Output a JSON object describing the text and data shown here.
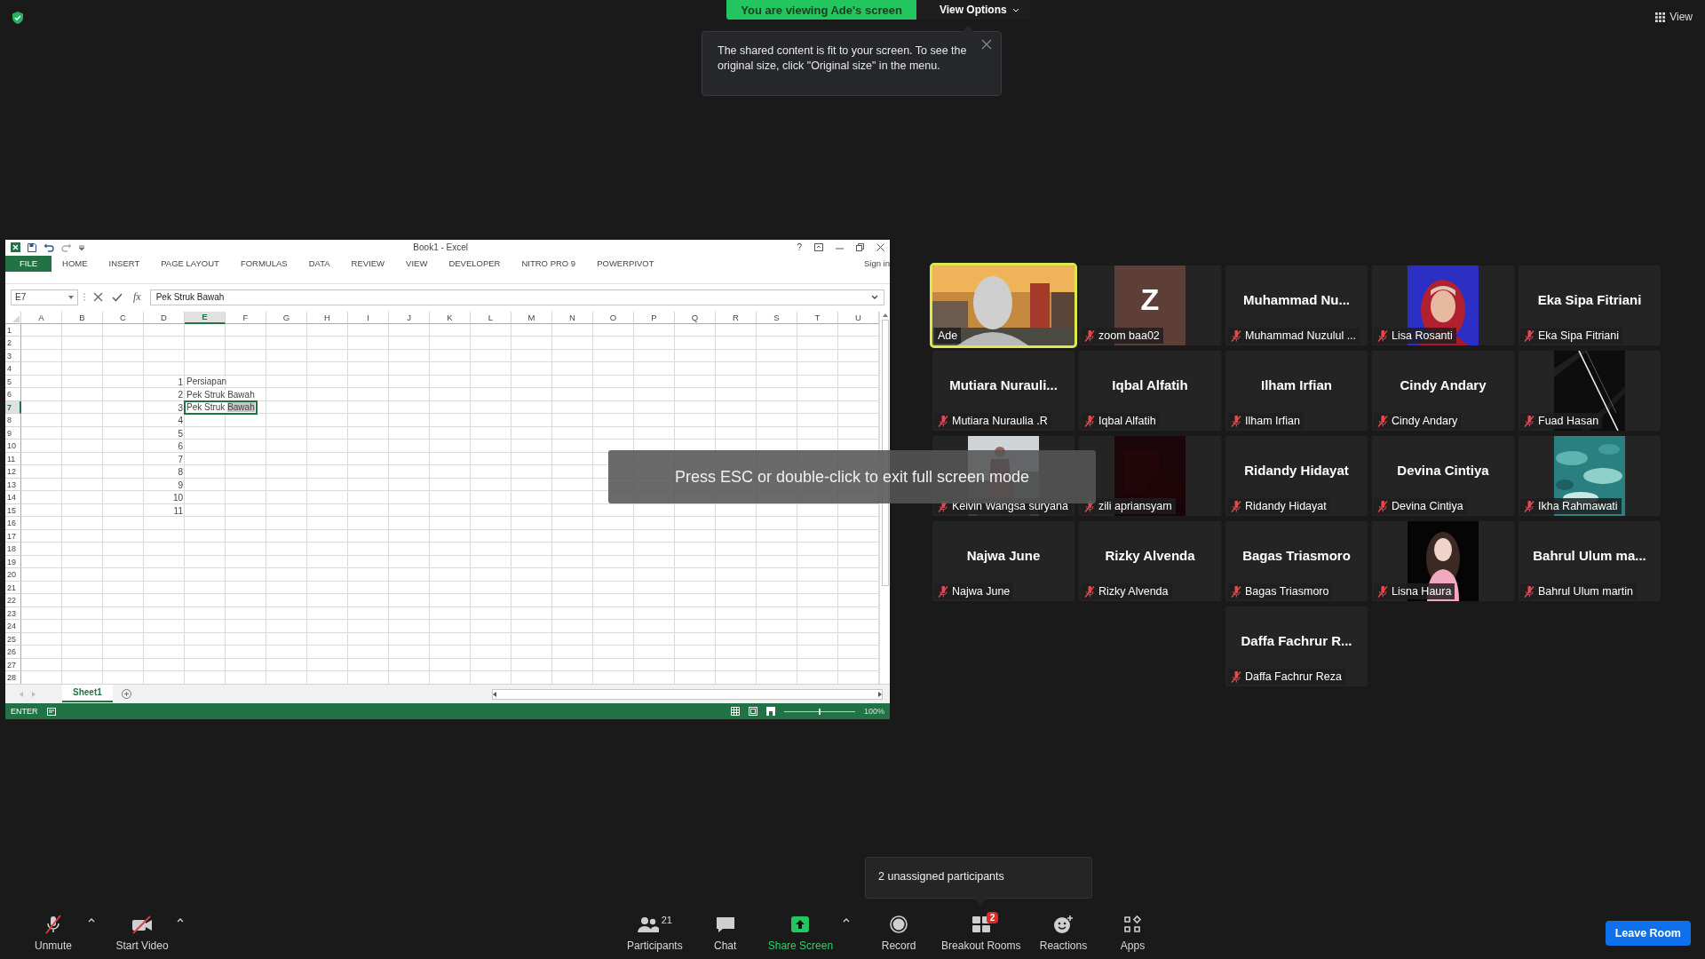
{
  "top_bar": {
    "sharing_banner": "You are viewing Ade's screen",
    "view_options": "View Options",
    "view_button": "View"
  },
  "notice": {
    "text": "The shared content is fit to your screen. To see the original size, click \"Original size\" in the menu."
  },
  "excel": {
    "title": "Book1 - Excel",
    "help": "?",
    "ribbon_tabs": [
      {
        "label": "FILE",
        "selected": true
      },
      {
        "label": "HOME",
        "selected": false
      },
      {
        "label": "INSERT",
        "selected": false
      },
      {
        "label": "PAGE LAYOUT",
        "selected": false
      },
      {
        "label": "FORMULAS",
        "selected": false
      },
      {
        "label": "DATA",
        "selected": false
      },
      {
        "label": "REVIEW",
        "selected": false
      },
      {
        "label": "VIEW",
        "selected": false
      },
      {
        "label": "DEVELOPER",
        "selected": false
      },
      {
        "label": "NITRO PRO 9",
        "selected": false
      },
      {
        "label": "POWERPIVOT",
        "selected": false
      }
    ],
    "sign_in": "Sign in",
    "name_box": "E7",
    "function_label": "fx",
    "formula": "Pek Struk Bawah",
    "columns": [
      {
        "label": "A",
        "selected": false
      },
      {
        "label": "B",
        "selected": false
      },
      {
        "label": "C",
        "selected": false
      },
      {
        "label": "D",
        "selected": false
      },
      {
        "label": "E",
        "selected": true
      },
      {
        "label": "F",
        "selected": false
      },
      {
        "label": "G",
        "selected": false
      },
      {
        "label": "H",
        "selected": false
      },
      {
        "label": "I",
        "selected": false
      },
      {
        "label": "J",
        "selected": false
      },
      {
        "label": "K",
        "selected": false
      },
      {
        "label": "L",
        "selected": false
      },
      {
        "label": "M",
        "selected": false
      },
      {
        "label": "N",
        "selected": false
      },
      {
        "label": "O",
        "selected": false
      },
      {
        "label": "P",
        "selected": false
      },
      {
        "label": "Q",
        "selected": false
      },
      {
        "label": "R",
        "selected": false
      },
      {
        "label": "S",
        "selected": false
      },
      {
        "label": "T",
        "selected": false
      },
      {
        "label": "U",
        "selected": false
      }
    ],
    "rows": [
      {
        "label": "1",
        "selected": false
      },
      {
        "label": "2",
        "selected": false
      },
      {
        "label": "3",
        "selected": false
      },
      {
        "label": "4",
        "selected": false
      },
      {
        "label": "5",
        "selected": false,
        "cells": {
          "D": {
            "kind": "number",
            "value": "1"
          },
          "E": {
            "kind": "text",
            "value": "Persiapan",
            "active": false
          }
        }
      },
      {
        "label": "6",
        "selected": false,
        "cells": {
          "D": {
            "kind": "number",
            "value": "2"
          },
          "E": {
            "kind": "text",
            "value": "Pek Struk Bawah",
            "active": false
          }
        }
      },
      {
        "label": "7",
        "selected": true,
        "cells": {
          "D": {
            "kind": "number",
            "value": "3"
          },
          "E": {
            "kind": "text",
            "active": true,
            "parts": [
              {
                "text": "Pek Struk ",
                "highlighted": false
              },
              {
                "text": "Bawah",
                "highlighted": true
              }
            ]
          }
        }
      },
      {
        "label": "8",
        "selected": false,
        "cells": {
          "D": {
            "kind": "number",
            "value": "4"
          }
        }
      },
      {
        "label": "9",
        "selected": false,
        "cells": {
          "D": {
            "kind": "number",
            "value": "5"
          }
        }
      },
      {
        "label": "10",
        "selected": false,
        "cells": {
          "D": {
            "kind": "number",
            "value": "6"
          }
        }
      },
      {
        "label": "11",
        "selected": false,
        "cells": {
          "D": {
            "kind": "number",
            "value": "7"
          }
        }
      },
      {
        "label": "12",
        "selected": false,
        "cells": {
          "D": {
            "kind": "number",
            "value": "8"
          }
        }
      },
      {
        "label": "13",
        "selected": false,
        "cells": {
          "D": {
            "kind": "number",
            "value": "9"
          }
        }
      },
      {
        "label": "14",
        "selected": false,
        "cells": {
          "D": {
            "kind": "number",
            "value": "10"
          }
        }
      },
      {
        "label": "15",
        "selected": false,
        "cells": {
          "D": {
            "kind": "number",
            "value": "11"
          }
        }
      },
      {
        "label": "16",
        "selected": false
      },
      {
        "label": "17",
        "selected": false
      },
      {
        "label": "18",
        "selected": false
      },
      {
        "label": "19",
        "selected": false
      },
      {
        "label": "20",
        "selected": false
      },
      {
        "label": "21",
        "selected": false
      },
      {
        "label": "22",
        "selected": false
      },
      {
        "label": "23",
        "selected": false
      },
      {
        "label": "24",
        "selected": false
      },
      {
        "label": "25",
        "selected": false
      },
      {
        "label": "26",
        "selected": false
      },
      {
        "label": "27",
        "selected": false
      },
      {
        "label": "28",
        "selected": false
      }
    ],
    "sheet_tabs": [
      {
        "label": "Sheet1",
        "selected": true
      }
    ],
    "status": "ENTER",
    "zoom_slider": {
      "level": 0.5
    },
    "zoom": "100%"
  },
  "fullscreen_hint": "Press ESC or double-click to exit full screen mode",
  "participants": [
    {
      "kind": "video",
      "label": "Ade",
      "speaking": true,
      "muted": false
    },
    {
      "kind": "letter",
      "letter": "Z",
      "label": "zoom baa02",
      "speaking": false,
      "muted": true
    },
    {
      "kind": "name",
      "display_name": "Muhammad  Nu...",
      "label": "Muhammad Nuzulul ...",
      "speaking": false,
      "muted": true
    },
    {
      "kind": "picture",
      "label": "Lisa Rosanti",
      "speaking": false,
      "muted": true
    },
    {
      "kind": "name",
      "display_name": "Eka Sipa Fitriani",
      "label": "Eka Sipa Fitriani",
      "speaking": false,
      "muted": true
    },
    {
      "kind": "name",
      "display_name": "Mutiara  Nurauli...",
      "label": "Mutiara Nuraulia .R",
      "speaking": false,
      "muted": true
    },
    {
      "kind": "name",
      "display_name": "Iqbal Alfatih",
      "label": "Iqbal Alfatih",
      "speaking": false,
      "muted": true
    },
    {
      "kind": "name",
      "display_name": "Ilham Irfian",
      "label": "Ilham Irfian",
      "speaking": false,
      "muted": true
    },
    {
      "kind": "name",
      "display_name": "Cindy Andary",
      "label": "Cindy Andary",
      "speaking": false,
      "muted": true
    },
    {
      "kind": "picture",
      "label": "Fuad Hasan",
      "speaking": false,
      "muted": true
    },
    {
      "kind": "picture",
      "label": "Kelvin Wangsa suryana",
      "speaking": false,
      "muted": true
    },
    {
      "kind": "picture",
      "label": "zili apriansyam",
      "speaking": false,
      "muted": true
    },
    {
      "kind": "name",
      "display_name": "Ridandy Hidayat",
      "label": "Ridandy Hidayat",
      "speaking": false,
      "muted": true
    },
    {
      "kind": "name",
      "display_name": "Devina Cintiya",
      "label": "Devina Cintiya",
      "speaking": false,
      "muted": true
    },
    {
      "kind": "picture",
      "label": "Ikha Rahmawati",
      "speaking": false,
      "muted": true
    },
    {
      "kind": "name",
      "display_name": "Najwa June",
      "label": "Najwa June",
      "speaking": false,
      "muted": true
    },
    {
      "kind": "name",
      "display_name": "Rizky Alvenda",
      "label": "Rizky Alvenda",
      "speaking": false,
      "muted": true
    },
    {
      "kind": "name",
      "display_name": "Bagas Triasmoro",
      "label": "Bagas Triasmoro",
      "speaking": false,
      "muted": true
    },
    {
      "kind": "picture",
      "label": "Lisna Haura",
      "speaking": false,
      "muted": true
    },
    {
      "kind": "name",
      "display_name": "Bahrul Ulum  ma...",
      "label": "Bahrul Ulum martin",
      "speaking": false,
      "muted": true
    },
    {
      "kind": "name",
      "display_name": "Daffa Fachrur R...",
      "label": "Daffa Fachrur Reza",
      "speaking": false,
      "muted": true
    }
  ],
  "unassigned_popup": "2 unassigned participants",
  "toolbar": {
    "left_items": [
      {
        "kind": "mic_off",
        "label": "Unmute",
        "caret": true,
        "highlighted": false
      },
      {
        "kind": "video_off",
        "label": "Start Video",
        "caret": true,
        "highlighted": false
      }
    ],
    "center_items": [
      {
        "kind": "participants",
        "label": "Participants",
        "count": "21",
        "caret": false,
        "highlighted": false
      },
      {
        "kind": "chat",
        "label": "Chat",
        "caret": false,
        "highlighted": false
      },
      {
        "kind": "share",
        "label": "Share Screen",
        "caret": true,
        "highlighted": true
      },
      {
        "kind": "record",
        "label": "Record",
        "caret": false,
        "highlighted": false
      },
      {
        "kind": "breakout",
        "label": "Breakout Rooms",
        "badge": "2",
        "caret": false,
        "highlighted": false
      },
      {
        "kind": "reactions",
        "label": "Reactions",
        "caret": false,
        "highlighted": false
      },
      {
        "kind": "apps",
        "label": "Apps",
        "caret": false,
        "highlighted": false
      }
    ],
    "leave_button": "Leave Room"
  }
}
